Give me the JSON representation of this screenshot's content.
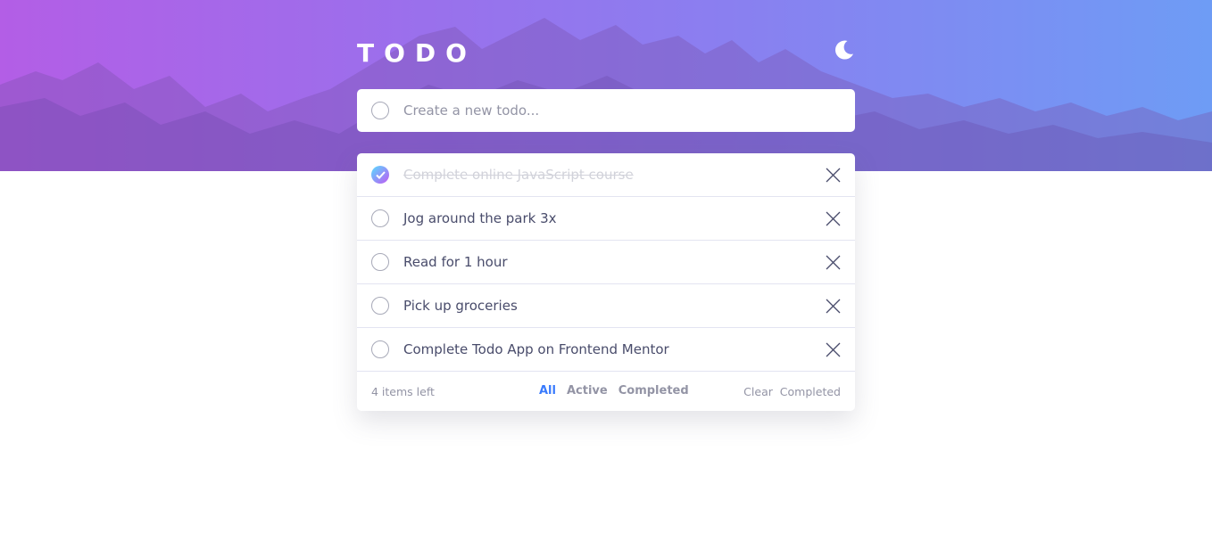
{
  "header": {
    "title": "TODO",
    "theme_icon": "moon-icon"
  },
  "new_todo": {
    "placeholder": "Create a new todo..."
  },
  "todos": [
    {
      "text": "Complete online JavaScript course",
      "completed": true
    },
    {
      "text": "Jog around the park 3x",
      "completed": false
    },
    {
      "text": "Read for 1 hour",
      "completed": false
    },
    {
      "text": "Pick up groceries",
      "completed": false
    },
    {
      "text": "Complete Todo App on Frontend Mentor",
      "completed": false
    }
  ],
  "footer": {
    "items_left": "4 items left",
    "filters": [
      {
        "label": "All",
        "active": true
      },
      {
        "label": "Active",
        "active": false
      },
      {
        "label": "Completed",
        "active": false
      }
    ],
    "clear_label": "Clear  Completed"
  },
  "colors": {
    "accent": "#3a7bfd",
    "check_gradient_start": "#57ddff",
    "check_gradient_end": "#c058f3",
    "text": "#494c6b",
    "muted": "#9394a5"
  }
}
